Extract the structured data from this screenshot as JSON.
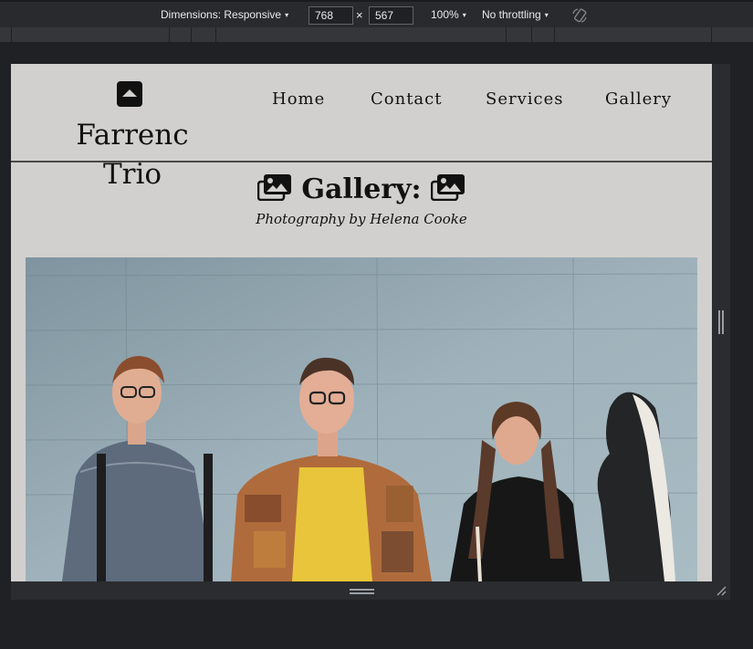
{
  "devtools": {
    "dimensions_label": "Dimensions: Responsive",
    "width_value": "768",
    "height_value": "567",
    "times": "×",
    "zoom": "100%",
    "throttling": "No throttling",
    "caret": "▾"
  },
  "site": {
    "logo_line1": "Farrenc",
    "logo_line2": "Trio",
    "nav": [
      "Home",
      "Contact",
      "Services",
      "Gallery"
    ]
  },
  "gallery": {
    "title": "Gallery:",
    "subtitle": "Photography by Helena Cooke"
  },
  "colors": {
    "page_bg": "#d1d0ce",
    "devtools_bg": "#202124",
    "text": "#111111"
  }
}
